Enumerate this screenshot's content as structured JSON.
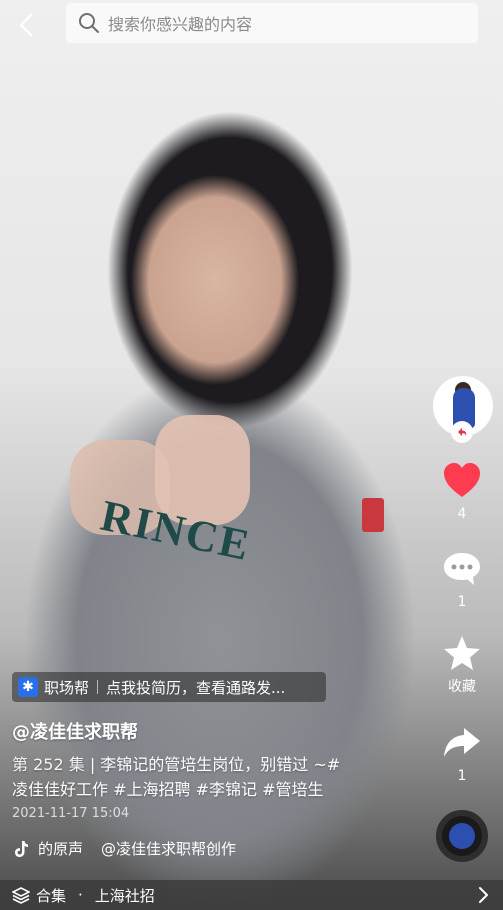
{
  "search": {
    "placeholder": "搜索你感兴趣的内容"
  },
  "rail": {
    "like_count": "4",
    "comment_count": "1",
    "favorite_label": "收藏",
    "share_count": "1",
    "like_color": "#ff3b4f"
  },
  "caption": {
    "tag_app": "职场帮",
    "tag_text": "点我投简历，查看通路发...",
    "author": "@凌佳佳求职帮",
    "episode": "第 252 集",
    "desc_line1": "李锦记的管培生岗位，别错过 ~#",
    "desc_line2": "凌佳佳好工作 #上海招聘 #李锦记 #管培生",
    "timestamp": "2021-11-17 15:04",
    "music_source": "的原声",
    "music_author": "@凌佳佳求职帮创作"
  },
  "bottom": {
    "collection_label": "合集",
    "location": "上海社招"
  }
}
